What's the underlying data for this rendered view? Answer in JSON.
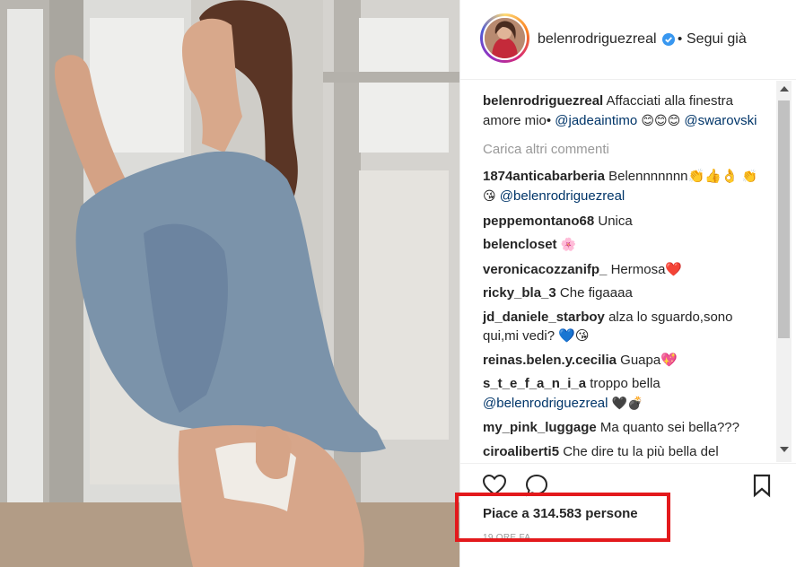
{
  "post": {
    "username": "belenrodriguezreal",
    "follow_status": "Segui già",
    "dot": "•"
  },
  "caption": {
    "username": "belenrodriguezreal",
    "text": "Affacciati alla finestra amore mio•",
    "mention1": "@jadeaintimo",
    "emoji": "😊😊😊",
    "mention2": "@swarovski"
  },
  "load_more": "Carica altri commenti",
  "comments": [
    {
      "user": "1874anticabarberia",
      "text": "Belennnnnnn👏👍👌",
      "text2": "👏😘",
      "mention": "@belenrodriguezreal"
    },
    {
      "user": "peppemontano68",
      "text": "Unica"
    },
    {
      "user": "belencloset",
      "text": "🌸"
    },
    {
      "user": "veronicacozzanifp_",
      "text": "Hermosa❤️"
    },
    {
      "user": "ricky_bla_3",
      "text": "Che figaaaa"
    },
    {
      "user": "jd_daniele_starboy",
      "text": "alza lo sguardo,sono qui,mi vedi? 💙😘"
    },
    {
      "user": "reinas.belen.y.cecilia",
      "text": "Guapa💖"
    },
    {
      "user": "s_t_e_f_a_n_i_a",
      "text": "troppo bella",
      "mention": "@belenrodriguezreal",
      "text2": "🖤💣"
    },
    {
      "user": "my_pink_luggage",
      "text": "Ma quanto sei bella???"
    },
    {
      "user": "ciroaliberti5",
      "text": "Che dire tu la più bella del"
    }
  ],
  "likes_label": "Piace a 314.583 persone",
  "timestamp": "19 ORE FA",
  "icons": {
    "like": "heart-icon",
    "comment": "comment-icon",
    "save": "bookmark-icon",
    "verified": "verified-badge-icon"
  },
  "colors": {
    "highlight_border": "#e3191c",
    "mention": "#003569",
    "muted": "#999999",
    "verified": "#3897f0"
  }
}
